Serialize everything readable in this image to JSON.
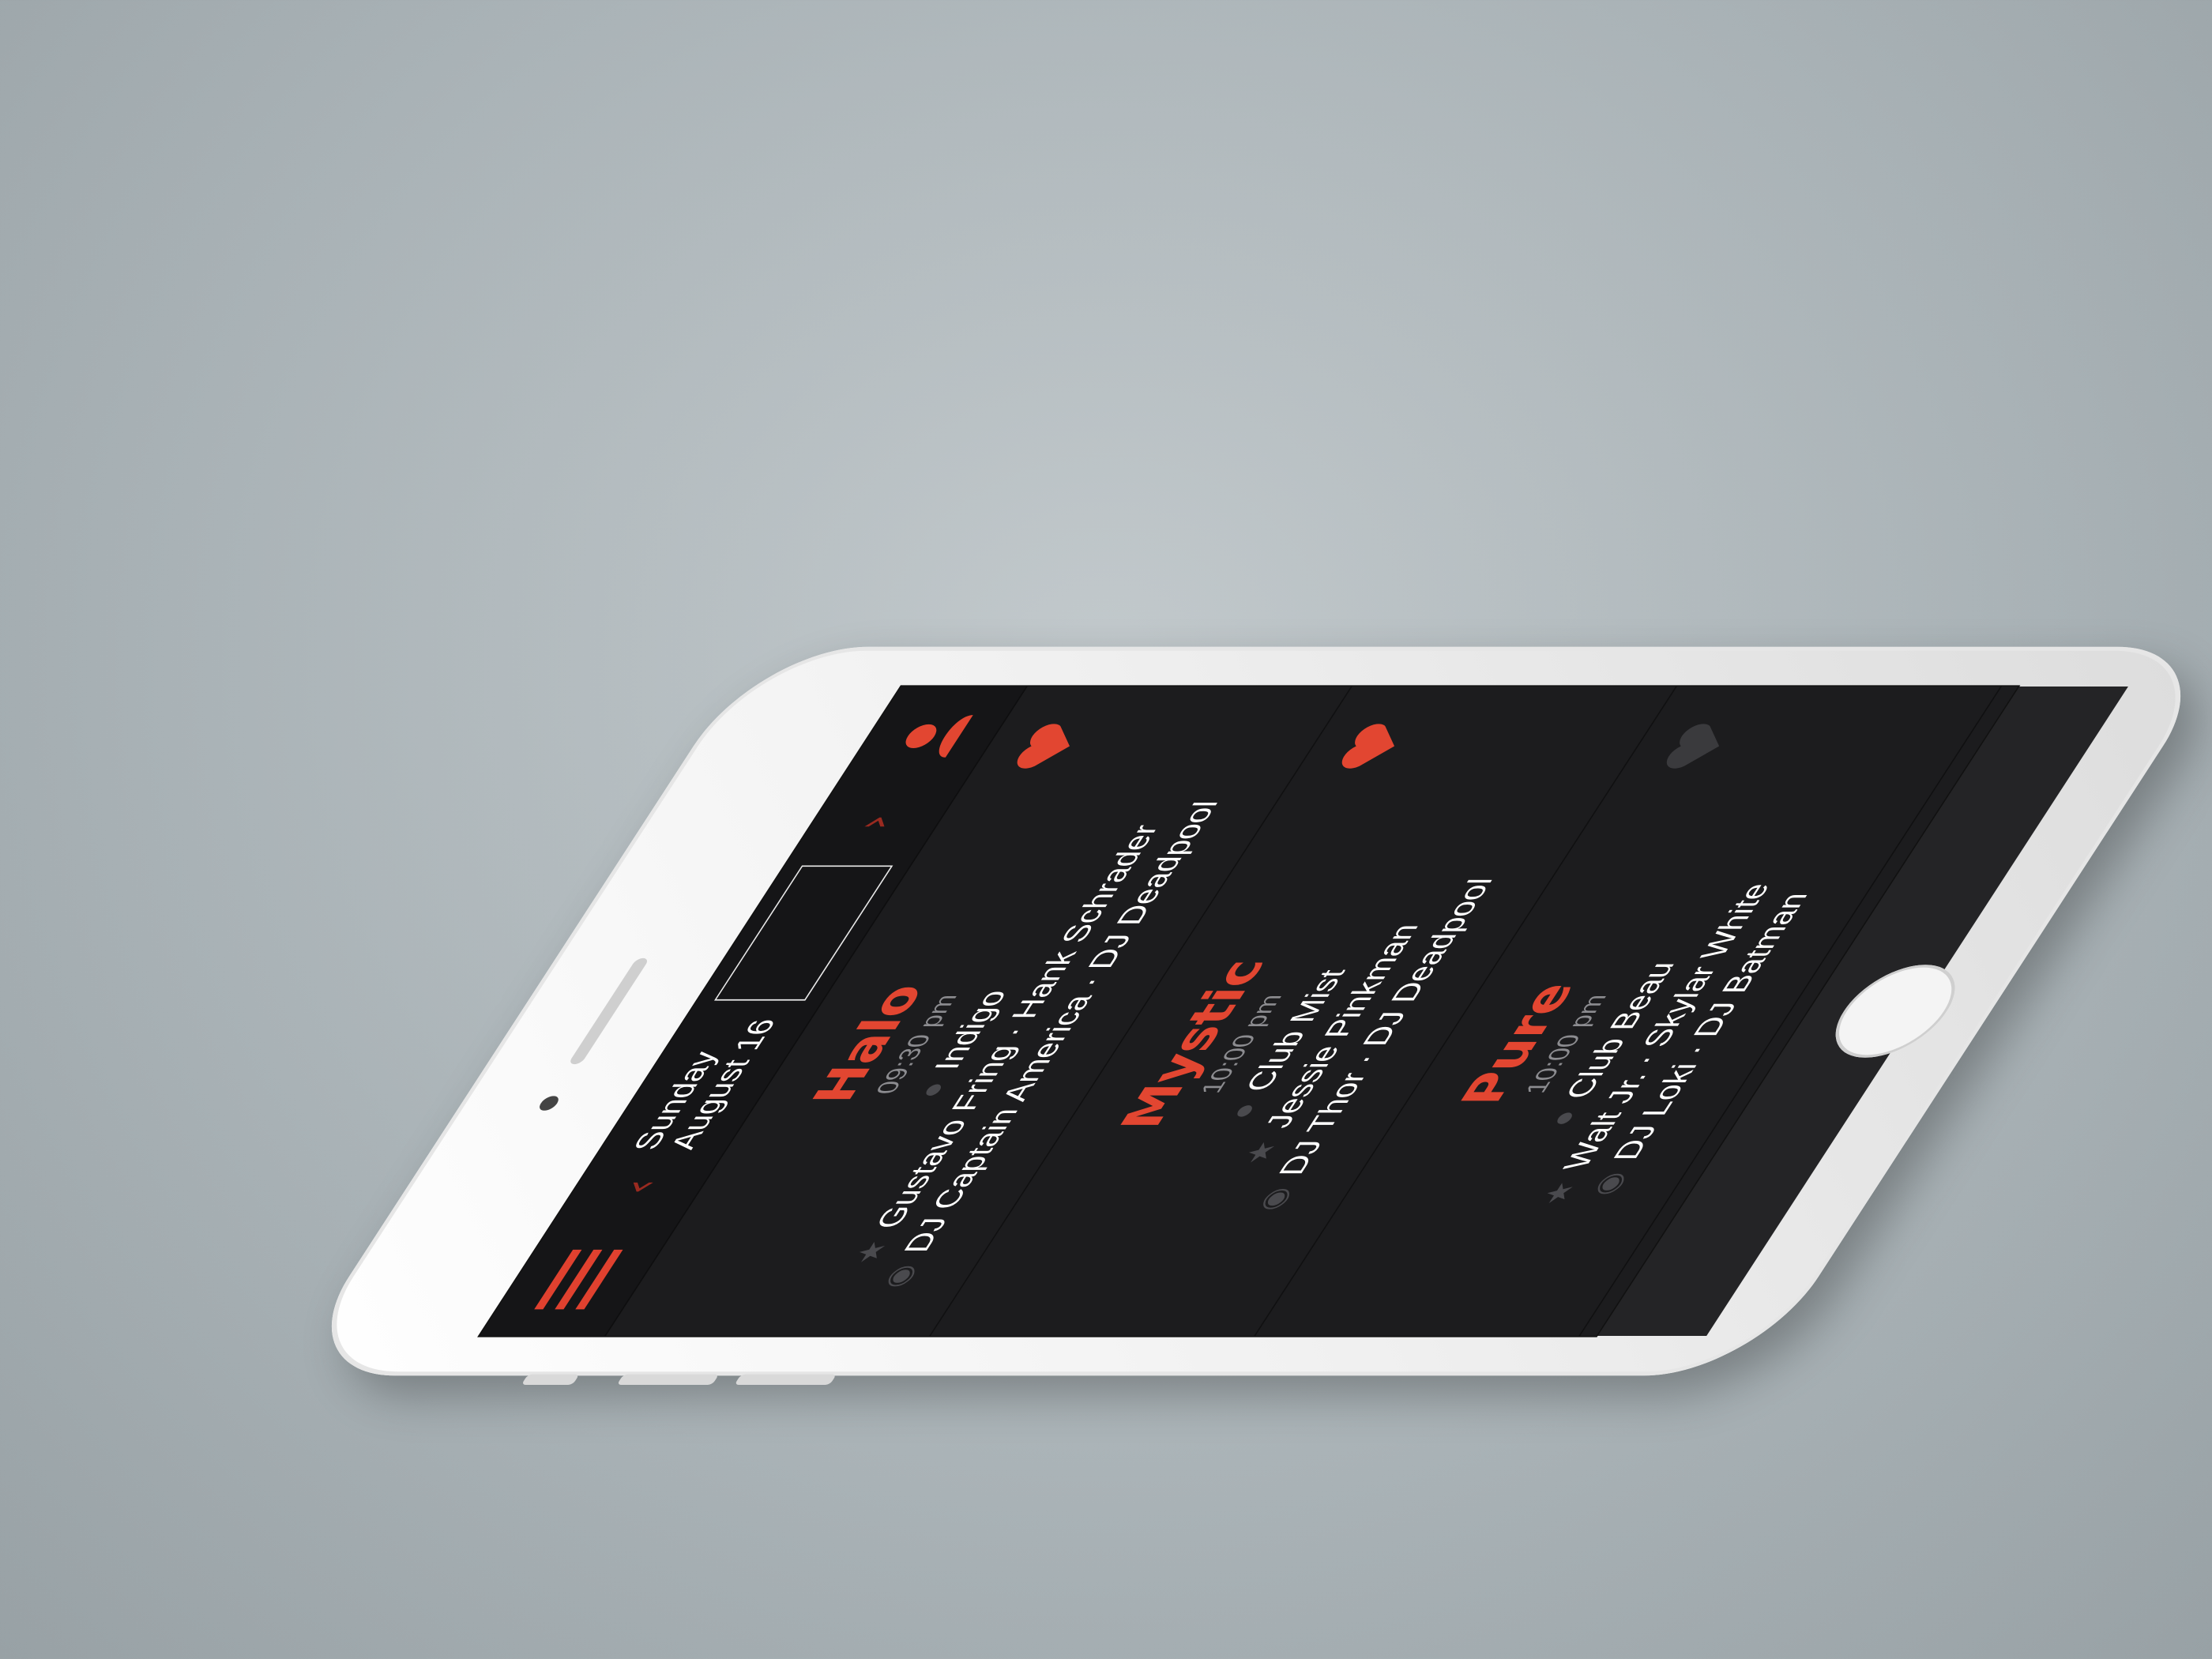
{
  "header": {
    "date": "Sunday August 16",
    "prev_icon": "chevron-left",
    "next_icon": "chevron-right",
    "menu_icon": "hamburger",
    "profile_icon": "user"
  },
  "colors": {
    "accent": "#e24631",
    "background": "#1c1c1e",
    "favorite_active": "#e24631",
    "favorite_inactive": "#3a3a3d"
  },
  "events": [
    {
      "club": "Halo",
      "time": "09:30 pm",
      "venue": "Indigo",
      "performers": "Gustavo Fring · Hank Schrader",
      "djs": "DJ Captain America · DJ Deadpool",
      "favorited": true
    },
    {
      "club": "Mystic",
      "time": "10:00 pm",
      "venue": "Club Mist",
      "performers": "Jessie Pinkman",
      "djs": "DJ Thor · DJ Deadpool",
      "favorited": true
    },
    {
      "club": "Pure",
      "time": "10:00 pm",
      "venue": "Club Beau",
      "performers": "Walt Jr. · Skylar White",
      "djs": "DJ Loki · DJ Batman",
      "favorited": false
    }
  ]
}
